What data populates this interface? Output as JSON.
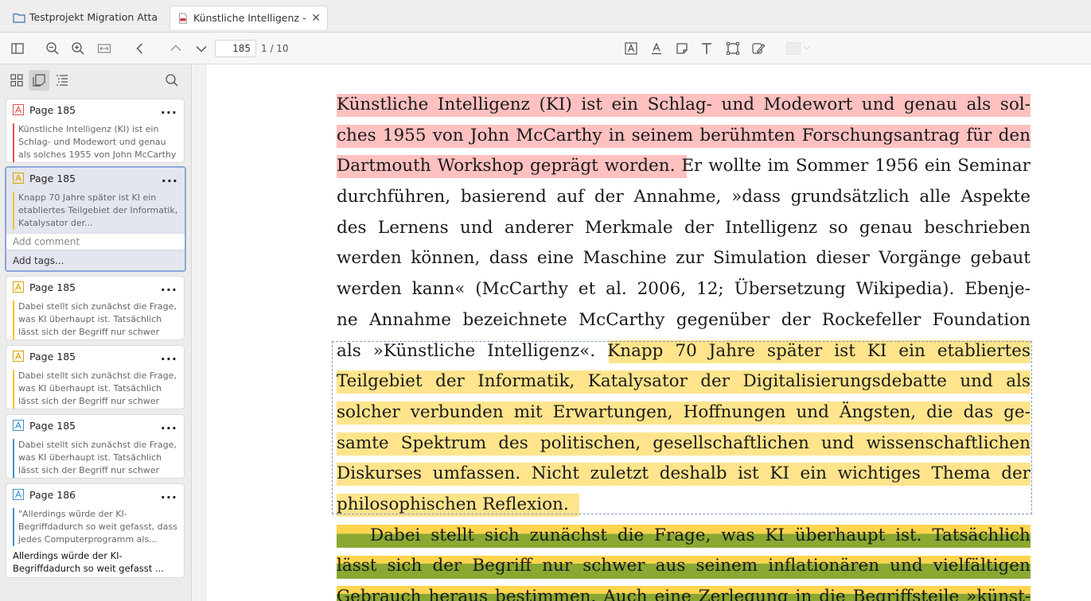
{
  "tabs": [
    {
      "label": "Testprojekt Migration Attach",
      "icon": "folder-icon"
    },
    {
      "label": "Künstliche Intelligenz - Sei",
      "icon": "pdf-icon",
      "close": "✕"
    }
  ],
  "toolbar": {
    "page_value": "185",
    "page_count": "1 / 10"
  },
  "colors": {
    "red": "#ffc0c0",
    "yellow": "#ffe48c",
    "green": "#8ba832",
    "blue": "#3c91c7",
    "selection": "#8fa6d8"
  },
  "annotations": [
    {
      "page": "Page 185",
      "color": "red",
      "text": "Künstliche Intelligenz (KI) ist ein Schlag- und Modewort und genau als solches 1955 von John McCarthy in...",
      "more": "..."
    },
    {
      "page": "Page 185",
      "color": "yellow",
      "text": "Knapp 70 Jahre später ist KI ein etabliertes Teilgebiet der Informatik, Katalysator der...",
      "more": "...",
      "comment_placeholder": "Add comment",
      "tags": "Add tags..."
    },
    {
      "page": "Page 185",
      "color": "yellow",
      "text": "Dabei stellt sich zunächst die Frage, was KI überhaupt ist. Tatsächlich lässt sich der Begriff nur schwer aus...",
      "more": "..."
    },
    {
      "page": "Page 185",
      "color": "yellow",
      "text": "Dabei stellt sich zunächst die Frage, was KI überhaupt ist. Tatsächlich lässt sich der Begriff nur schwer aus...",
      "more": "..."
    },
    {
      "page": "Page 185",
      "color": "blue",
      "text": "Dabei stellt sich zunächst die Frage, was KI überhaupt ist. Tatsächlich lässt sich der Begriff nur schwer aus...",
      "more": "..."
    },
    {
      "page": "Page 186",
      "color": "blue",
      "text": "\"Allerdings würde der KI-Begriffdadurch so weit gefasst, dass jedes Computerprogramm als...",
      "more": "...",
      "comment": "Allerdings würde der KI-Begriffdadurch so weit gefasst ..."
    }
  ],
  "doc": {
    "lines": [
      {
        "words": [
          "Künstliche Intelligenz (KI) ist ein Schlag- und Modewort und genau als sol-"
        ]
      },
      {
        "words": [
          "ches 1955 von John McCarthy in seinem berühmten Forschungsantrag für den"
        ]
      },
      {
        "words": [
          "Dartmouth Workshop geprägt worden. Er wollte im Sommer 1956 ein Seminar"
        ]
      },
      {
        "words": [
          "durchführen, basierend auf der Annahme, »dass grundsätzlich alle Aspekte"
        ]
      },
      {
        "words": [
          "des Lernens und anderer Merkmale der Intelligenz so genau beschrieben"
        ]
      },
      {
        "words": [
          "werden können, dass eine Maschine zur Simulation dieser Vorgänge gebaut"
        ]
      },
      {
        "words": [
          "werden kann« (McCarthy et al. 2006, 12; Übersetzung Wikipedia). Ebenje-"
        ]
      },
      {
        "words": [
          "ne Annahme bezeichnete McCarthy gegenüber der Rockefeller Foundation"
        ]
      },
      {
        "words": [
          "als »Künstliche Intelligenz«. Knapp 70 Jahre später ist KI ein etabliertes"
        ]
      },
      {
        "words": [
          "Teilgebiet der Informatik, Katalysator der Digitalisierungsdebatte und als"
        ]
      },
      {
        "words": [
          "solcher verbunden mit Erwartungen, Hoffnungen und Ängsten, die das ge-"
        ]
      },
      {
        "words": [
          "samte Spektrum des politischen, gesellschaftlichen und wissenschaftlichen"
        ]
      },
      {
        "words": [
          "Diskurses umfassen. Nicht zuletzt deshalb ist KI ein wichtiges Thema der"
        ]
      },
      {
        "words": [
          "philosophischen Reflexion."
        ]
      },
      {
        "words": [
          "Dabei stellt sich zunächst die Frage, was KI überhaupt ist. Tatsächlich"
        ]
      },
      {
        "words": [
          "lässt sich der Begriff nur schwer aus seinem inflationären und vielfältigen"
        ]
      },
      {
        "words": [
          "Gebrauch heraus bestimmen. Auch eine Zerlegung in die Begriffsteile »künst-"
        ]
      }
    ]
  }
}
